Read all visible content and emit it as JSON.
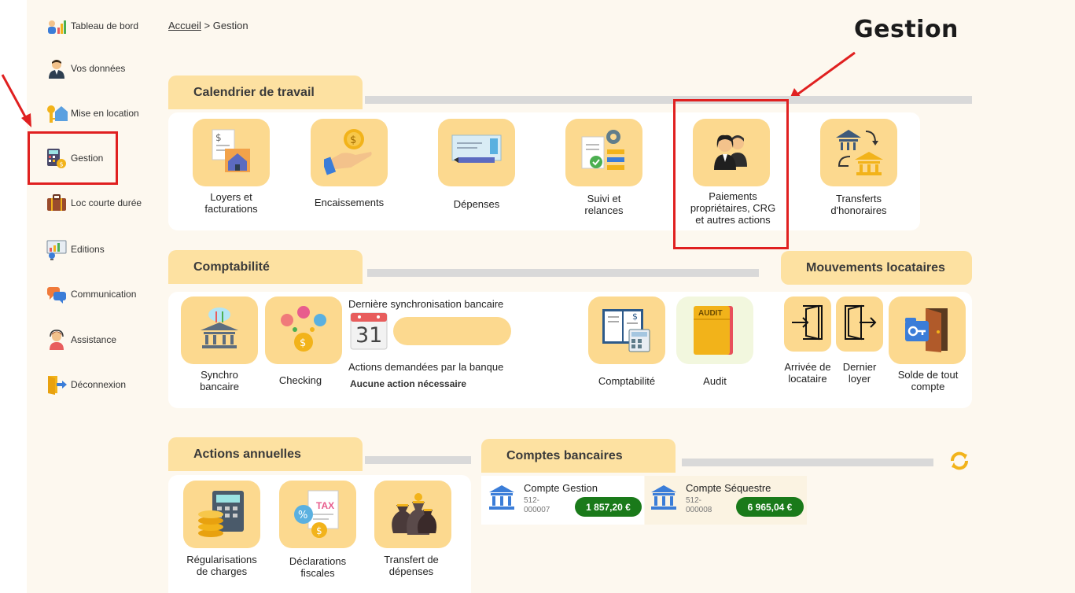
{
  "sidebar": {
    "items": [
      {
        "label": "Tableau de bord",
        "icon": "dashboard-icon"
      },
      {
        "label": "Vos données",
        "icon": "user-icon"
      },
      {
        "label": "Mise en location",
        "icon": "key-house-icon"
      },
      {
        "label": "Gestion",
        "icon": "calculator-icon"
      },
      {
        "label": "Loc courte durée",
        "icon": "suitcase-icon"
      },
      {
        "label": "Editions",
        "icon": "report-icon"
      },
      {
        "label": "Communication",
        "icon": "chat-icon"
      },
      {
        "label": "Assistance",
        "icon": "support-agent-icon"
      },
      {
        "label": "Déconnexion",
        "icon": "logout-icon"
      }
    ]
  },
  "breadcrumb": {
    "home": "Accueil",
    "sep": ">",
    "current": "Gestion"
  },
  "page_title": "Gestion",
  "sections": {
    "calendrier": {
      "title": "Calendrier de travail",
      "tiles": [
        {
          "label": "Loyers et\nfacturations",
          "icon": "invoice-house-icon"
        },
        {
          "label": "Encaissements",
          "icon": "coin-hand-icon"
        },
        {
          "label": "Dépenses",
          "icon": "cheque-icon"
        },
        {
          "label": "Suivi et\nrelances",
          "icon": "tracking-gear-icon"
        },
        {
          "label": "Paiements\npropriétaires, CRG\net autres actions",
          "icon": "owners-icon"
        },
        {
          "label": "Transferts\nd'honoraires",
          "icon": "bank-transfer-icon"
        }
      ]
    },
    "comptabilite": {
      "title": "Comptabilité",
      "sync_title": "Dernière synchronisation bancaire",
      "calendar_day": "31",
      "bank_actions_title": "Actions demandées par la banque",
      "bank_actions_value": "Aucune action nécessaire",
      "tiles": [
        {
          "label": "Synchro\nbancaire",
          "icon": "bank-sync-icon"
        },
        {
          "label": "Checking",
          "icon": "checking-coins-icon"
        },
        {
          "label": "Comptabilité",
          "icon": "ledger-icon"
        },
        {
          "label": "Audit",
          "icon": "audit-folder-icon",
          "badge": "AUDIT"
        }
      ]
    },
    "mouvements": {
      "title": "Mouvements locataires",
      "tiles": [
        {
          "label": "Arrivée de\nlocataire",
          "icon": "door-enter-icon"
        },
        {
          "label": "Dernier\nloyer",
          "icon": "door-exit-icon"
        },
        {
          "label": "Solde de tout\ncompte",
          "icon": "key-door-icon"
        }
      ]
    },
    "annuelles": {
      "title": "Actions annuelles",
      "tiles": [
        {
          "label": "Régularisations\nde charges",
          "icon": "calculator-coins-icon"
        },
        {
          "label": "Déclarations\nfiscales",
          "icon": "tax-icon",
          "badge": "TAX"
        },
        {
          "label": "Transfert de\ndépenses",
          "icon": "money-bags-icon"
        }
      ]
    },
    "comptes": {
      "title": "Comptes bancaires",
      "accounts": [
        {
          "name": "Compte Gestion",
          "number": "512-\n000007",
          "balance": "1 857,20 €"
        },
        {
          "name": "Compte Séquestre",
          "number": "512-\n000008",
          "balance": "6 965,04 €"
        }
      ]
    }
  },
  "colors": {
    "accent": "#fde1a1",
    "tile": "#fcd98f",
    "highlight": "#e02020",
    "balance": "#1a7a1a",
    "refresh": "#f2b31a"
  }
}
